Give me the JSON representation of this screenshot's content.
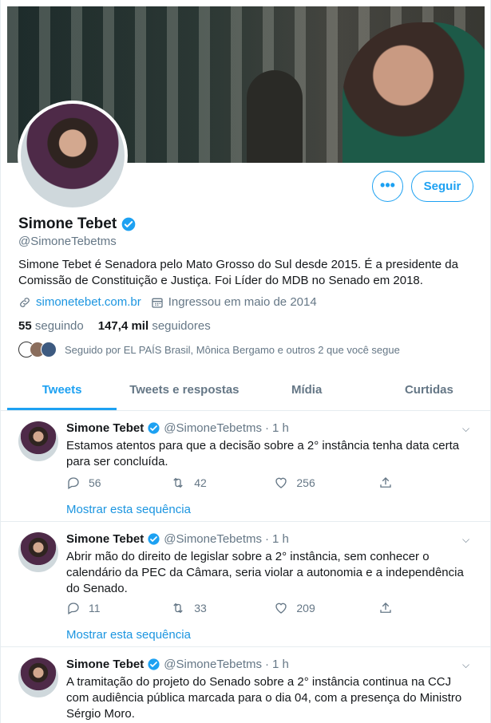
{
  "profile": {
    "name": "Simone Tebet",
    "handle": "@SimoneTebetms",
    "bio": "Simone Tebet é Senadora pelo Mato Grosso do Sul desde 2015. É a presidente da Comissão de Constituição e Justiça. Foi Líder do MDB no Senado em 2018.",
    "website": "simonetebet.com.br",
    "joined": "Ingressou em maio de 2014",
    "following_count": "55",
    "following_label": "seguindo",
    "followers_count": "147,4 mil",
    "followers_label": "seguidores",
    "followed_by": "Seguido por EL PAÍS Brasil, Mônica Bergamo e outros 2 que você segue"
  },
  "buttons": {
    "more": "•••",
    "follow": "Seguir"
  },
  "tabs": [
    {
      "label": "Tweets"
    },
    {
      "label": "Tweets e respostas"
    },
    {
      "label": "Mídia"
    },
    {
      "label": "Curtidas"
    }
  ],
  "tweets": [
    {
      "name": "Simone Tebet",
      "handle": "@SimoneTebetms",
      "sep": "·",
      "time": "1 h",
      "text": "Estamos atentos para que a decisão sobre a 2° instância tenha data certa para ser concluída.",
      "replies": "56",
      "retweets": "42",
      "likes": "256",
      "show_thread": "Mostrar esta sequência"
    },
    {
      "name": "Simone Tebet",
      "handle": "@SimoneTebetms",
      "sep": "·",
      "time": "1 h",
      "text": "Abrir mão do direito de legislar sobre a 2° instância, sem conhecer o calendário da PEC da Câmara, seria violar a autonomia e a independência do Senado.",
      "replies": "11",
      "retweets": "33",
      "likes": "209",
      "show_thread": "Mostrar esta sequência"
    },
    {
      "name": "Simone Tebet",
      "handle": "@SimoneTebetms",
      "sep": "·",
      "time": "1 h",
      "text": "A tramitação do projeto do Senado sobre a 2° instância continua na CCJ com audiência pública marcada para o dia 04, com a presença do Ministro Sérgio Moro."
    }
  ],
  "colors": {
    "accent": "#1da1f2",
    "link": "#1b95e0",
    "muted": "#657786"
  }
}
